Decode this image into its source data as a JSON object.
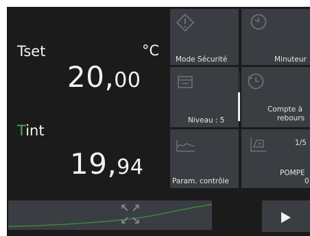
{
  "setpoint": {
    "label_main": "Tset",
    "unit": "°C",
    "value_int": "20,",
    "value_dec": "00"
  },
  "internal": {
    "label_first": "T",
    "label_rest": "int",
    "value_int": "19,",
    "value_dec": "94"
  },
  "tiles": {
    "safety_mode": "Mode Sécurité",
    "timer": "Minuteur",
    "level": "Niveau : 5",
    "countdown_line1": "Compte à",
    "countdown_line2": "rebours",
    "control_params": "Param. contrôle",
    "program_page": "1/5",
    "program_name": "POMPE",
    "program_num": "0"
  },
  "colors": {
    "accent_green": "#4caf50",
    "tile_bg": "#3a3d42",
    "screen_bg": "#1b1b1b"
  },
  "icons": {
    "safety": "warning-diamond-icon",
    "timer": "clock-icon",
    "level": "level-icon",
    "countdown": "countdown-icon",
    "control": "graph-icon",
    "program": "program-icon",
    "expand": "expand-arrows-icon",
    "play": "play-icon"
  }
}
